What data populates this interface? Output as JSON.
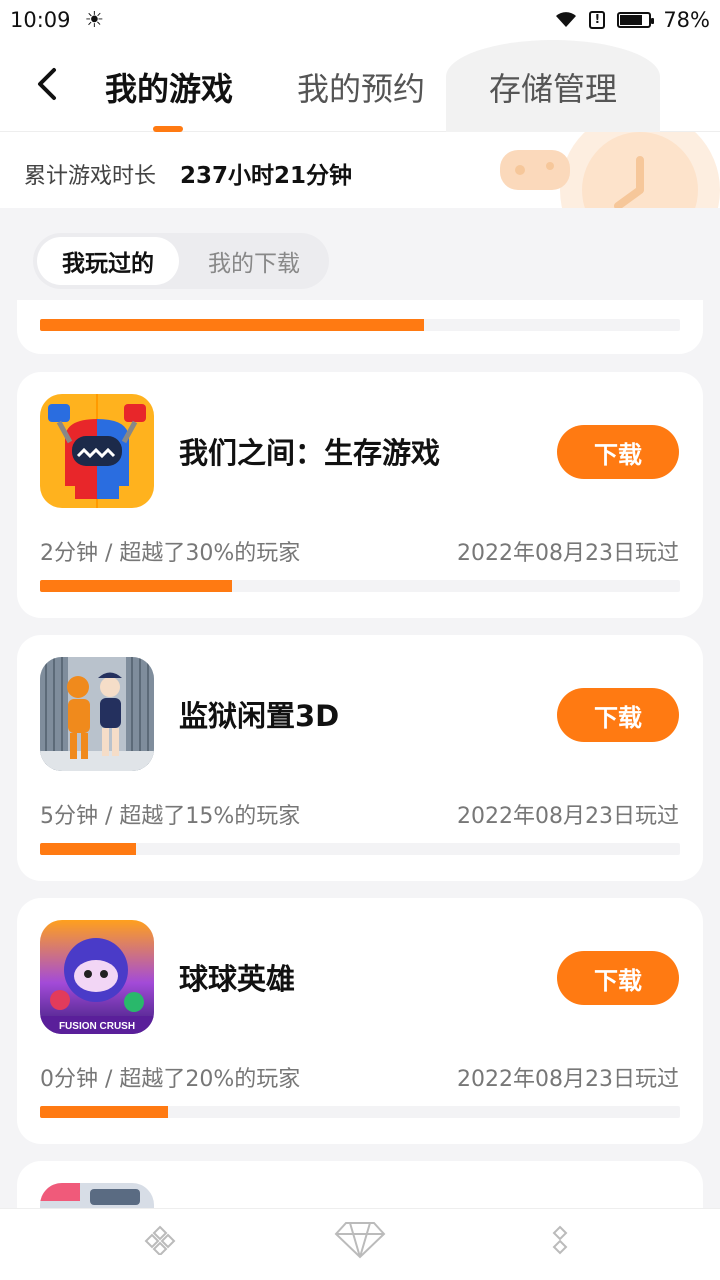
{
  "status_bar": {
    "time": "10:09",
    "battery_percent": "78%",
    "battery_level": 0.78
  },
  "header": {
    "tabs": [
      {
        "label": "我的游戏",
        "active": true
      },
      {
        "label": "我的预约",
        "active": false
      },
      {
        "label": "存储管理",
        "active": false
      }
    ]
  },
  "summary": {
    "label": "累计游戏时长",
    "value": "237小时21分钟"
  },
  "filter": {
    "options": [
      "我玩过的",
      "我的下载"
    ],
    "selected": "我玩过的"
  },
  "partial_card": {
    "progress": 0.6
  },
  "games": [
    {
      "name": "我们之间：生存游戏",
      "button": "下载",
      "stats": "2分钟 / 超越了30%的玩家",
      "date": "2022年08月23日玩过",
      "progress": 0.3,
      "icon": "among-us-style-icon"
    },
    {
      "name": "监狱闲置3D",
      "button": "下载",
      "stats": "5分钟 / 超越了15%的玩家",
      "date": "2022年08月23日玩过",
      "progress": 0.15,
      "icon": "prison-icon"
    },
    {
      "name": "球球英雄",
      "button": "下载",
      "stats": "0分钟 / 超越了20%的玩家",
      "date": "2022年08月23日玩过",
      "progress": 0.2,
      "icon": "fusion-crush-icon",
      "icon_text": "FUSION CRUSH"
    }
  ],
  "colors": {
    "accent": "#ff7a12",
    "background": "#f4f4f6"
  }
}
